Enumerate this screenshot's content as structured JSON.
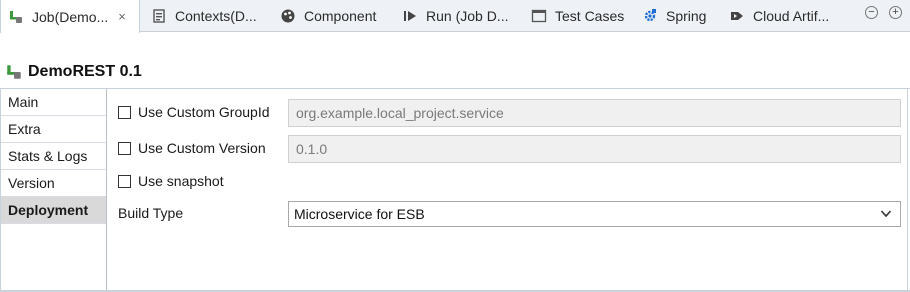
{
  "tabs": [
    {
      "label": "Job(Demo...",
      "icon": "job-icon",
      "active": true,
      "close": "×"
    },
    {
      "label": "Contexts(D...",
      "icon": "contexts-icon"
    },
    {
      "label": "Component",
      "icon": "component-icon"
    },
    {
      "label": "Run (Job D...",
      "icon": "run-icon"
    },
    {
      "label": "Test Cases",
      "icon": "test-cases-icon"
    },
    {
      "label": "Spring",
      "icon": "spring-icon"
    },
    {
      "label": "Cloud Artif...",
      "icon": "cloud-artifact-icon"
    }
  ],
  "window_controls": {
    "minimize": "−",
    "maximize": "+"
  },
  "header": {
    "title": "DemoREST 0.1",
    "icon": "job-icon"
  },
  "sidebar": {
    "items": [
      {
        "label": "Main"
      },
      {
        "label": "Extra"
      },
      {
        "label": "Stats & Logs"
      },
      {
        "label": "Version"
      },
      {
        "label": "Deployment",
        "selected": true
      }
    ]
  },
  "form": {
    "custom_group_id": {
      "label": "Use Custom GroupId",
      "checked": false,
      "value": "org.example.local_project.service"
    },
    "custom_version": {
      "label": "Use Custom Version",
      "checked": false,
      "value": "0.1.0"
    },
    "snapshot": {
      "label": "Use snapshot",
      "checked": false
    },
    "build_type": {
      "label": "Build Type",
      "value": "Microservice for ESB"
    }
  },
  "colors": {
    "accent_green": "#3c9a3c",
    "selected_nav": "#d9d9d9",
    "disabled_field": "#f0f0f0"
  }
}
